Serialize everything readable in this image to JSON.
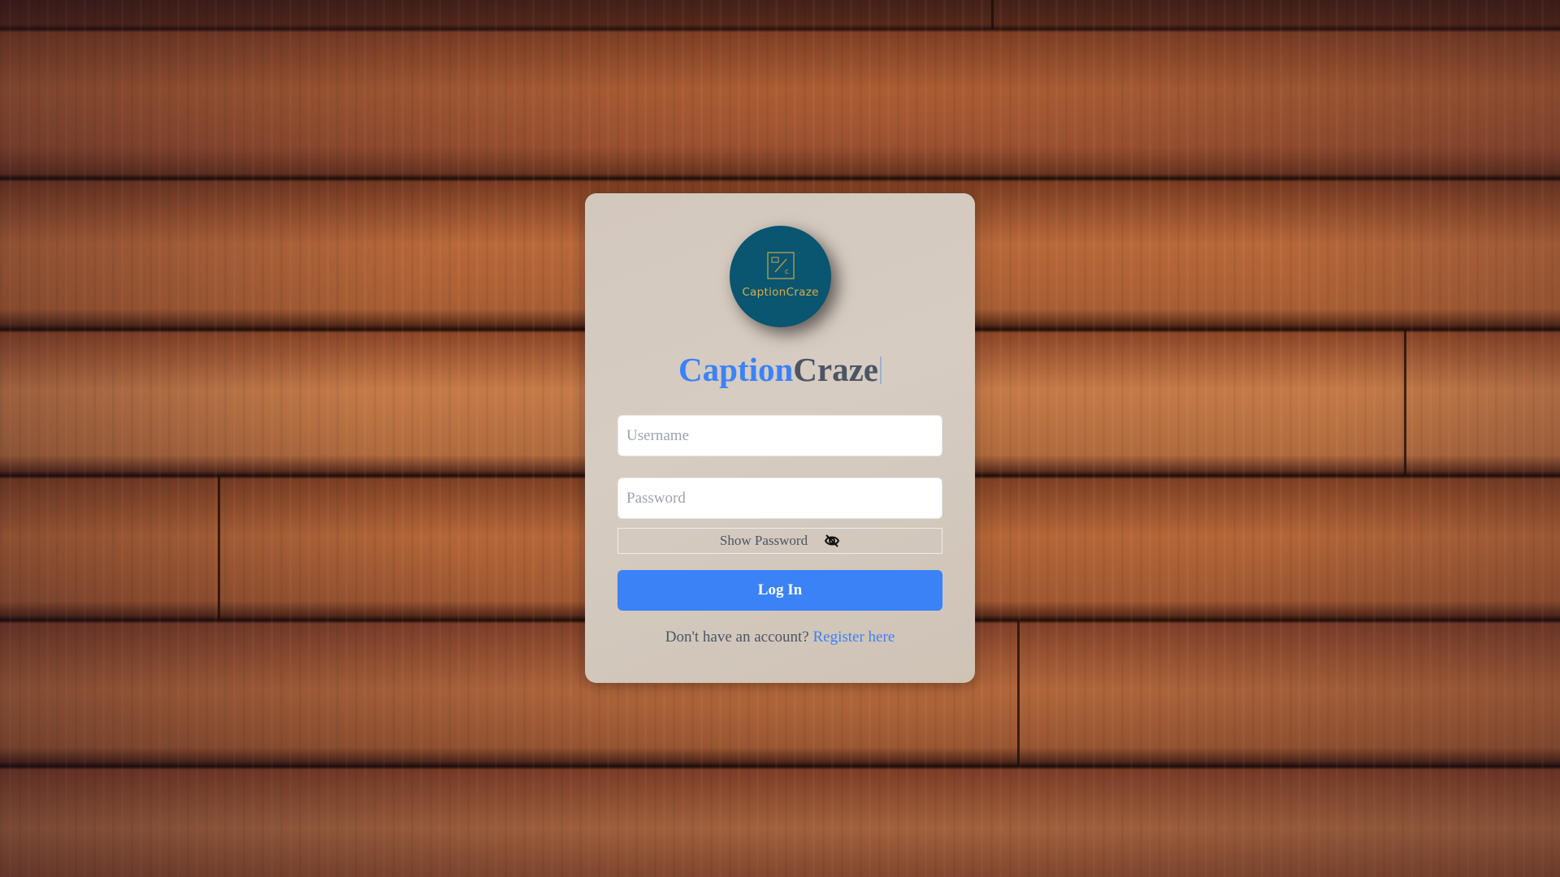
{
  "logo": {
    "text": "CaptionCraze",
    "icon": "caption-logo-icon",
    "bg_color": "#0a5570",
    "text_color": "#d4b048"
  },
  "title": {
    "part1": "Caption",
    "part2": "Craze"
  },
  "form": {
    "username_placeholder": "Username",
    "username_value": "",
    "password_placeholder": "Password",
    "password_value": "",
    "show_password_label": "Show Password",
    "show_password_icon": "eye-off-icon",
    "login_label": "Log In"
  },
  "register": {
    "prompt": "Don't have an account?",
    "link": "Register here"
  },
  "colors": {
    "accent": "#3b82f6",
    "text": "#4b5563"
  }
}
